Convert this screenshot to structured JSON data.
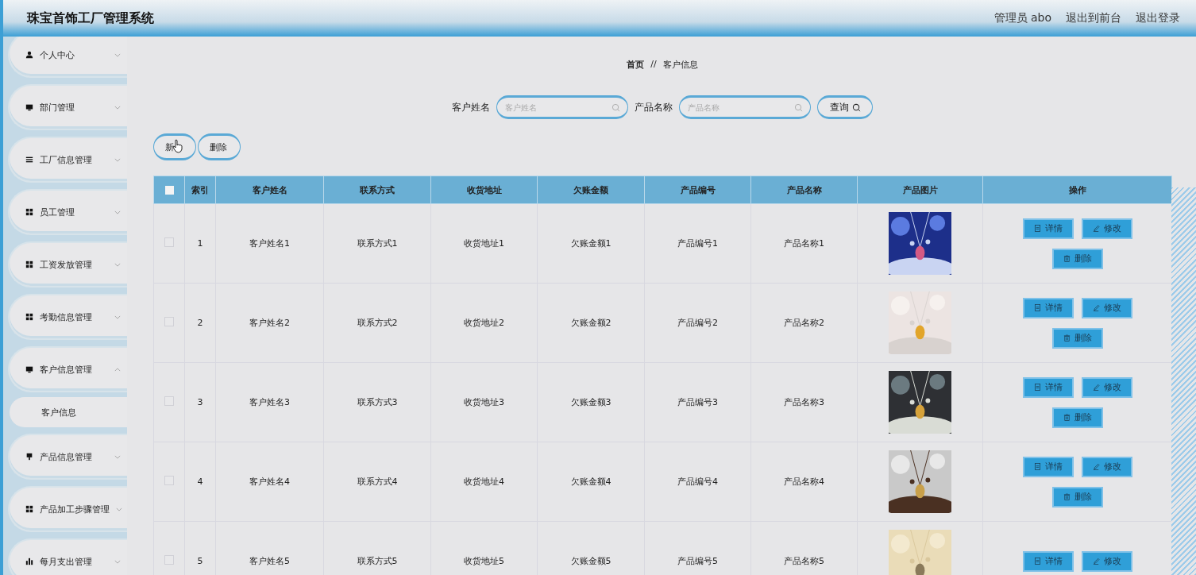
{
  "header": {
    "title": "珠宝首饰工厂管理系统",
    "user": "管理员 abo",
    "links": [
      "退出到前台",
      "退出登录"
    ]
  },
  "sidebar": {
    "items": [
      {
        "label": "个人中心",
        "expanded": false
      },
      {
        "label": "部门管理",
        "expanded": false
      },
      {
        "label": "工厂信息管理",
        "expanded": false
      },
      {
        "label": "员工管理",
        "expanded": false
      },
      {
        "label": "工资发放管理",
        "expanded": false
      },
      {
        "label": "考勤信息管理",
        "expanded": false
      },
      {
        "label": "客户信息管理",
        "expanded": true,
        "children": [
          {
            "label": "客户信息"
          }
        ]
      },
      {
        "label": "产品信息管理",
        "expanded": false
      },
      {
        "label": "产品加工步骤管理",
        "expanded": false
      },
      {
        "label": "每月支出管理",
        "expanded": false
      }
    ]
  },
  "breadcrumb": [
    "首页",
    "//",
    "客户信息"
  ],
  "search": {
    "fields": [
      {
        "label": "客户姓名",
        "placeholder": "客户姓名"
      },
      {
        "label": "产品名称",
        "placeholder": "产品名称"
      }
    ],
    "button": "查询"
  },
  "actions": [
    "新",
    "删除"
  ],
  "table": {
    "select_all": {
      "checked": false
    },
    "columns": [
      "索引",
      "客户姓名",
      "联系方式",
      "收货地址",
      "欠账金额",
      "产品编号",
      "产品名称",
      "产品图片",
      "操作"
    ],
    "rows": [
      {
        "checked": false,
        "cells": [
          "1",
          "客户姓名1",
          "联系方式1",
          "收货地址1",
          "欠账金额1",
          "产品编号1",
          "产品名称1"
        ],
        "buttons": [
          "详情",
          "修改",
          "删除"
        ]
      },
      {
        "checked": false,
        "cells": [
          "2",
          "客户姓名2",
          "联系方式2",
          "收货地址2",
          "欠账金额2",
          "产品编号2",
          "产品名称2"
        ],
        "buttons": [
          "详情",
          "修改",
          "删除"
        ]
      },
      {
        "checked": false,
        "cells": [
          "3",
          "客户姓名3",
          "联系方式3",
          "收货地址3",
          "欠账金额3",
          "产品编号3",
          "产品名称3"
        ],
        "buttons": [
          "详情",
          "修改",
          "删除"
        ]
      },
      {
        "checked": false,
        "cells": [
          "4",
          "客户姓名4",
          "联系方式4",
          "收货地址4",
          "欠账金额4",
          "产品编号4",
          "产品名称4"
        ],
        "buttons": [
          "详情",
          "修改",
          "删除"
        ]
      },
      {
        "checked": false,
        "cells": [
          "5",
          "客户姓名5",
          "联系方式5",
          "收货地址5",
          "欠账金额5",
          "产品编号5",
          "产品名称5"
        ],
        "buttons": [
          "详情",
          "修改"
        ]
      }
    ]
  }
}
